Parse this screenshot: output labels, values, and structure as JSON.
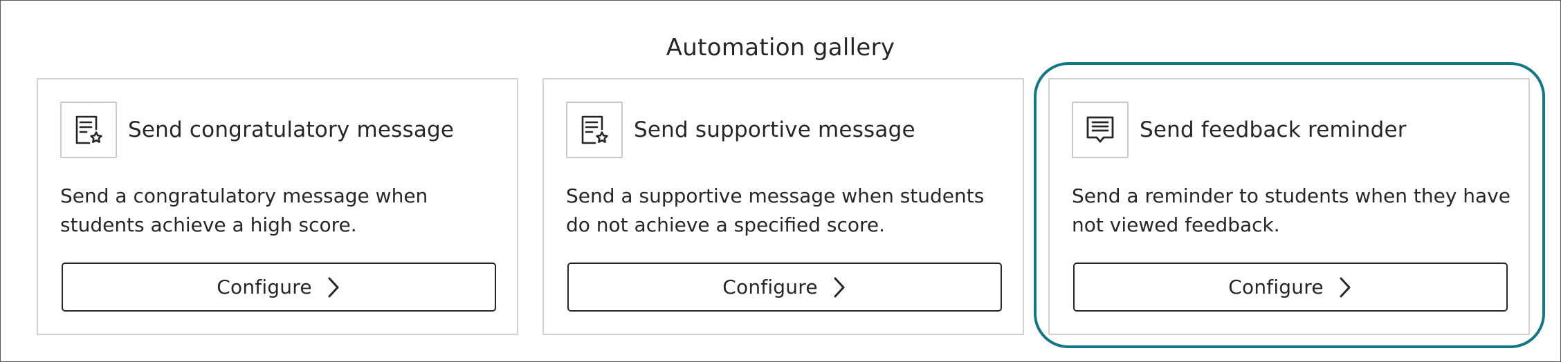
{
  "page": {
    "title": "Automation gallery"
  },
  "colors": {
    "highlight": "#147685",
    "text": "#262626",
    "card_border": "#d2d2d2"
  },
  "cards": [
    {
      "icon": "certificate-star-icon",
      "title": "Send congratulatory message",
      "description": "Send a congratulatory message when students achieve a high score.",
      "button_label": "Configure"
    },
    {
      "icon": "certificate-star-icon",
      "title": "Send supportive message",
      "description": "Send a supportive message when students do not achieve a specified score.",
      "button_label": "Configure"
    },
    {
      "icon": "message-bubble-icon",
      "title": "Send feedback reminder",
      "description": "Send a reminder to students when they have not viewed feedback.",
      "button_label": "Configure",
      "highlighted": true
    }
  ]
}
